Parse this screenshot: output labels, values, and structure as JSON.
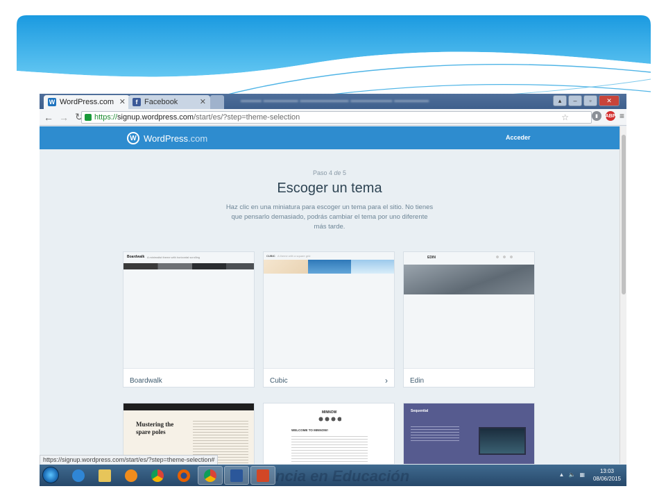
{
  "browser": {
    "tabs": [
      {
        "label": "WordPress.com",
        "favicon": "wordpress-icon",
        "active": true
      },
      {
        "label": "Facebook",
        "favicon": "facebook-icon",
        "active": false
      }
    ],
    "url": {
      "scheme": "https://",
      "host": "signup.wordpress.com",
      "path": "/start/es/?step=theme-selection"
    },
    "status_url": "https://signup.wordpress.com/start/es/?step=theme-selection#"
  },
  "site": {
    "brand_main": "WordPress",
    "brand_suffix": ".com",
    "login_label": "Acceder",
    "step_prefix": "Paso ",
    "step_current": "4",
    "step_of": " de ",
    "step_total": "5",
    "title": "Escoger un tema",
    "subtitle": "Haz clic en una miniatura para escoger un tema para el sitio. No tienes que pensarlo demasiado, podrás cambiar el tema por uno diferente más tarde."
  },
  "themes": [
    {
      "name": "Boardwalk",
      "thumb_title": "Boardwalk",
      "thumb_tagline": "A minimalist theme with horizontal scrolling"
    },
    {
      "name": "Cubic",
      "thumb_title": "CUBIC",
      "thumb_tagline": "A theme with a square grid"
    },
    {
      "name": "Edin",
      "thumb_title": "EDIN"
    },
    {
      "name": "Mustering the spare poles",
      "thumb_title": "Mustering the spare poles"
    },
    {
      "name": "Minnow",
      "thumb_title": "MINNOW",
      "thumb_heading": "WELCOME TO MINNOW!"
    },
    {
      "name": "Sequential",
      "thumb_title": "Sequential"
    }
  ],
  "taskbar": {
    "watermark": "ncia en Educación",
    "time": "13:03",
    "date": "08/06/2015",
    "apps": [
      "windows-explorer-icon",
      "internet-explorer-icon",
      "file-explorer-icon",
      "media-player-icon",
      "chrome-icon",
      "firefox-icon",
      "chrome-icon",
      "word-icon",
      "powerpoint-icon"
    ]
  },
  "colors": {
    "wp_blue": "#2e8ccf",
    "page_bg": "#e9eff3",
    "banner_sky": "#2aa6e6"
  }
}
